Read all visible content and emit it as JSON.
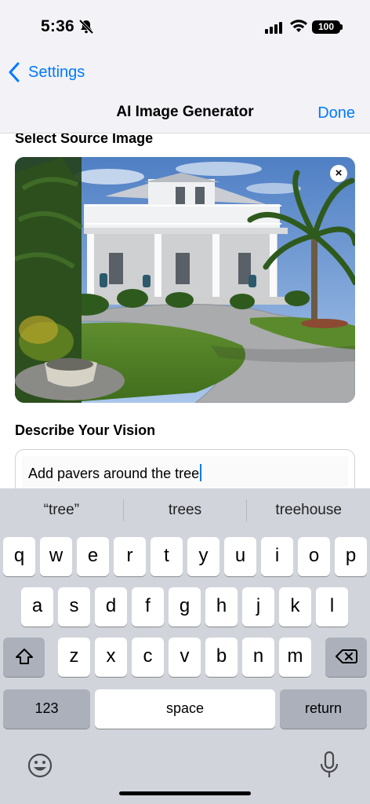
{
  "status": {
    "time": "5:36",
    "battery": "100"
  },
  "nav": {
    "back_label": "Settings",
    "title": "AI Image Generator",
    "done_label": "Done"
  },
  "content": {
    "select_heading": "Select Source Image",
    "remove_label": "×",
    "describe_heading": "Describe Your Vision",
    "vision_text": "Add pavers around the tree"
  },
  "keyboard": {
    "suggestions": [
      "“tree”",
      "trees",
      "treehouse"
    ],
    "row1": [
      "q",
      "w",
      "e",
      "r",
      "t",
      "y",
      "u",
      "i",
      "o",
      "p"
    ],
    "row2": [
      "a",
      "s",
      "d",
      "f",
      "g",
      "h",
      "j",
      "k",
      "l"
    ],
    "row3": [
      "z",
      "x",
      "c",
      "v",
      "b",
      "n",
      "m"
    ],
    "numbers_label": "123",
    "space_label": "space",
    "return_label": "return"
  },
  "icons": {
    "mute": "bell-slash-icon",
    "signal": "cellular-signal-icon",
    "wifi": "wifi-icon",
    "back": "chevron-left-icon",
    "shift": "shift-icon",
    "delete": "delete-backward-icon",
    "emoji": "emoji-icon",
    "mic": "microphone-icon"
  },
  "colors": {
    "accent": "#007aff",
    "keyboard_bg": "#d1d4db"
  }
}
